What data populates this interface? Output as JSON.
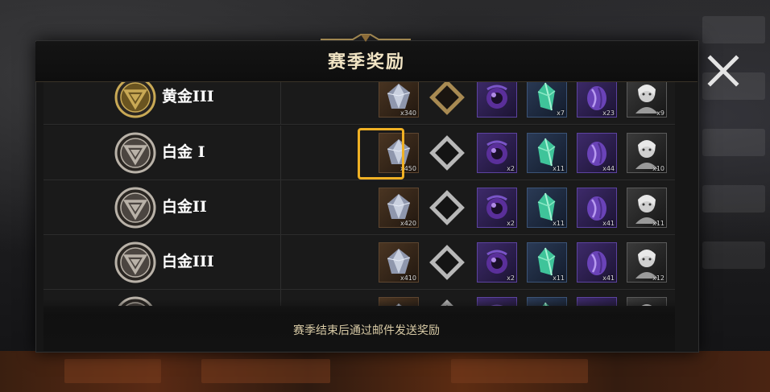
{
  "dialog": {
    "title": "赛季奖励",
    "footer_note": "赛季结束后通过邮件发送奖励",
    "close_icon": "close-icon"
  },
  "ranks": [
    {
      "label": "黄金III",
      "tier": "gold",
      "rewards": [
        {
          "icon": "diamond-ore-icon",
          "quality": "brown",
          "count": "x340"
        },
        {
          "icon": "gold-ring-frame-icon",
          "quality": "none",
          "count": ""
        },
        {
          "icon": "purple-orb-icon",
          "quality": "purple",
          "count": ""
        },
        {
          "icon": "green-crystal-icon",
          "quality": "blue",
          "count": "x7"
        },
        {
          "icon": "purple-stone-icon",
          "quality": "purple",
          "count": "x23"
        },
        {
          "icon": "portrait-fragment-icon",
          "quality": "gray",
          "count": "x9"
        }
      ]
    },
    {
      "label": "白金 I",
      "tier": "platinum",
      "selected": true,
      "rewards": [
        {
          "icon": "diamond-ore-icon",
          "quality": "brown",
          "count": "x450"
        },
        {
          "icon": "silver-ring-frame-icon",
          "quality": "none",
          "count": ""
        },
        {
          "icon": "purple-orb-icon",
          "quality": "purple",
          "count": "x2"
        },
        {
          "icon": "green-crystal-icon",
          "quality": "blue",
          "count": "x11"
        },
        {
          "icon": "purple-stone-icon",
          "quality": "purple",
          "count": "x44"
        },
        {
          "icon": "portrait-fragment-icon",
          "quality": "gray",
          "count": "x10"
        }
      ]
    },
    {
      "label": "白金II",
      "tier": "platinum",
      "rewards": [
        {
          "icon": "diamond-ore-icon",
          "quality": "brown",
          "count": "x420"
        },
        {
          "icon": "silver-ring-frame-icon",
          "quality": "none",
          "count": ""
        },
        {
          "icon": "purple-orb-icon",
          "quality": "purple",
          "count": "x2"
        },
        {
          "icon": "green-crystal-icon",
          "quality": "blue",
          "count": "x11"
        },
        {
          "icon": "purple-stone-icon",
          "quality": "purple",
          "count": "x41"
        },
        {
          "icon": "portrait-fragment-icon",
          "quality": "gray",
          "count": "x11"
        }
      ]
    },
    {
      "label": "白金III",
      "tier": "platinum",
      "rewards": [
        {
          "icon": "diamond-ore-icon",
          "quality": "brown",
          "count": "x410"
        },
        {
          "icon": "silver-ring-frame-icon",
          "quality": "none",
          "count": ""
        },
        {
          "icon": "purple-orb-icon",
          "quality": "purple",
          "count": "x2"
        },
        {
          "icon": "green-crystal-icon",
          "quality": "blue",
          "count": "x11"
        },
        {
          "icon": "purple-stone-icon",
          "quality": "purple",
          "count": "x41"
        },
        {
          "icon": "portrait-fragment-icon",
          "quality": "gray",
          "count": "x12"
        }
      ]
    },
    {
      "label": "",
      "tier": "platinum",
      "rewards": [
        {
          "icon": "diamond-ore-icon",
          "quality": "brown",
          "count": ""
        },
        {
          "icon": "silver-ring-frame-icon",
          "quality": "none",
          "count": ""
        },
        {
          "icon": "purple-orb-icon",
          "quality": "purple",
          "count": ""
        },
        {
          "icon": "green-crystal-icon",
          "quality": "blue",
          "count": ""
        },
        {
          "icon": "purple-stone-icon",
          "quality": "purple",
          "count": ""
        },
        {
          "icon": "portrait-fragment-icon",
          "quality": "gray",
          "count": ""
        }
      ]
    }
  ],
  "colors": {
    "accent_selection": "#f0b124",
    "title_text": "#f1e4c4",
    "footer_text": "#d9cba6",
    "gold_tier": "#c9a955",
    "platinum_tier": "#b9b2a8"
  }
}
